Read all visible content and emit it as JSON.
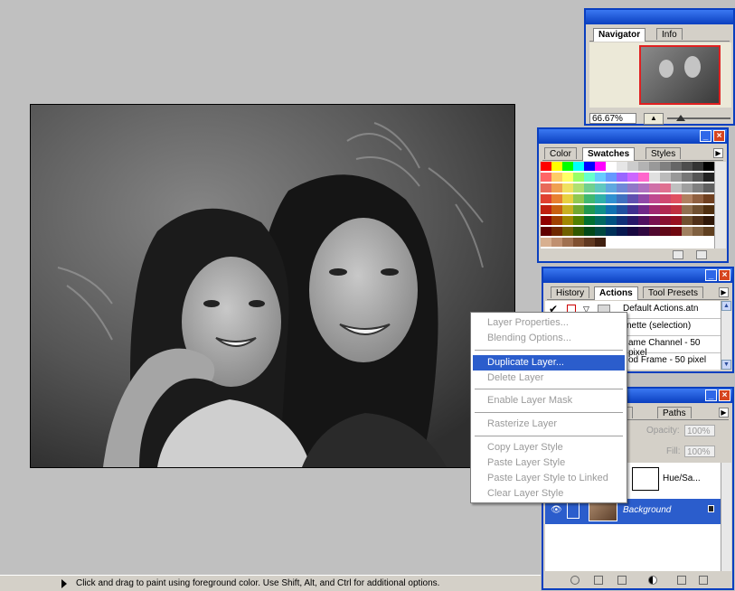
{
  "navigator": {
    "tabs": [
      "Navigator",
      "Info"
    ],
    "zoom": "66.67%"
  },
  "swatches_palette": {
    "tabs": [
      "Color",
      "Swatches",
      "Styles"
    ]
  },
  "actions_palette": {
    "tabs": [
      "History",
      "Actions",
      "Tool Presets"
    ],
    "rows": [
      "Default Actions.atn",
      "nette (selection)",
      "ame Channel - 50 pixel",
      "od Frame - 50 pixel"
    ]
  },
  "layers_palette": {
    "tabs": [
      "els",
      "Paths"
    ],
    "opacity_label": "Opacity:",
    "opacity_value": "100%",
    "fill_label": "Fill:",
    "fill_value": "100%",
    "layers": [
      {
        "name": "Hue/Sa..."
      },
      {
        "name": "Background"
      }
    ]
  },
  "context_menu": {
    "items": [
      {
        "label": "Layer Properties...",
        "enabled": false
      },
      {
        "label": "Blending Options...",
        "enabled": false
      },
      {
        "label": "Duplicate Layer...",
        "enabled": true
      },
      {
        "label": "Delete Layer",
        "enabled": false
      },
      {
        "label": "Enable Layer Mask",
        "enabled": false
      },
      {
        "label": "Rasterize Layer",
        "enabled": false
      },
      {
        "label": "Copy Layer Style",
        "enabled": false
      },
      {
        "label": "Paste Layer Style",
        "enabled": false
      },
      {
        "label": "Paste Layer Style to Linked",
        "enabled": false
      },
      {
        "label": "Clear Layer Style",
        "enabled": false
      }
    ]
  },
  "status_bar": {
    "text": "Click and drag to paint using foreground color.  Use Shift, Alt, and Ctrl for additional options."
  },
  "colors": {
    "title_bar": "#0a3fbf",
    "menu_highlight": "#2b5dcc",
    "selected_layer": "#2b5dcc"
  }
}
